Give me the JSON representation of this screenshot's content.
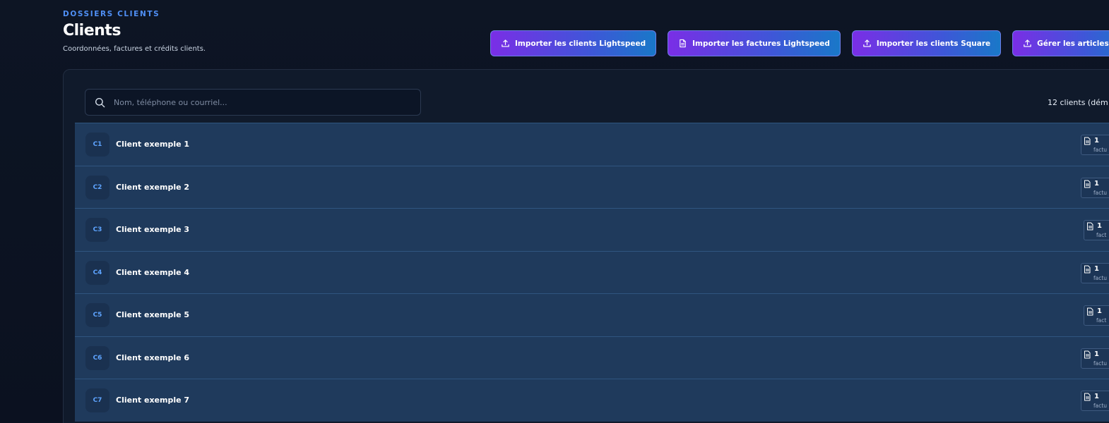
{
  "header": {
    "eyebrow": "DOSSIERS CLIENTS",
    "title": "Clients",
    "subtitle": "Coordonnées, factures et crédits clients."
  },
  "actions": [
    {
      "label": "Importer les clients Lightspeed",
      "icon": "upload-icon"
    },
    {
      "label": "Importer les factures Lightspeed",
      "icon": "document-icon"
    },
    {
      "label": "Importer les clients Square",
      "icon": "upload-icon"
    },
    {
      "label": "Gérer les articles Sq",
      "icon": "upload-icon"
    }
  ],
  "search": {
    "placeholder": "Nom, téléphone ou courriel...",
    "value": ""
  },
  "summary": {
    "count_text": "12 clients (dém"
  },
  "clients": [
    {
      "initials": "C1",
      "name": "Client exemple 1",
      "invoice_count": "1",
      "invoice_label": "factu"
    },
    {
      "initials": "C2",
      "name": "Client exemple 2",
      "invoice_count": "1",
      "invoice_label": "factu"
    },
    {
      "initials": "C3",
      "name": "Client exemple 3",
      "invoice_count": "1",
      "invoice_label": "fact"
    },
    {
      "initials": "C4",
      "name": "Client exemple 4",
      "invoice_count": "1",
      "invoice_label": "factu"
    },
    {
      "initials": "C5",
      "name": "Client exemple 5",
      "invoice_count": "1",
      "invoice_label": "fact"
    },
    {
      "initials": "C6",
      "name": "Client exemple 6",
      "invoice_count": "1",
      "invoice_label": "factu"
    },
    {
      "initials": "C7",
      "name": "Client exemple 7",
      "invoice_count": "1",
      "invoice_label": "factu"
    }
  ],
  "colors": {
    "accent": "#4f8ff5",
    "row_background": "#1f3a5c",
    "button_gradient_start": "#7a2ee6",
    "button_gradient_end": "#1978c8"
  }
}
